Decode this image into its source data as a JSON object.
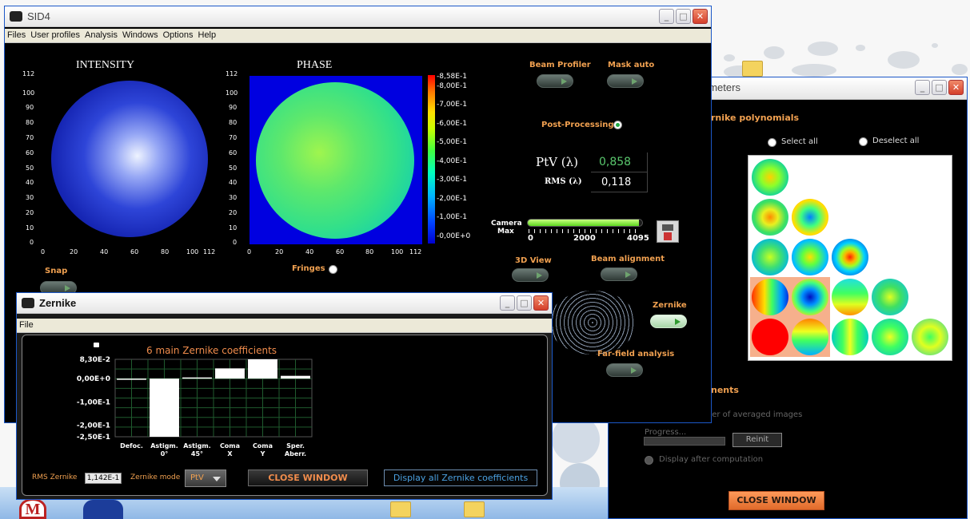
{
  "main_window": {
    "title": "SID4",
    "menu": [
      "Files",
      "User profiles",
      "Analysis",
      "Windows",
      "Options",
      "Help"
    ],
    "intensity": {
      "title": "INTENSITY",
      "y_ticks": [
        "112",
        "100",
        "90",
        "80",
        "70",
        "60",
        "50",
        "40",
        "30",
        "20",
        "10",
        "0"
      ],
      "x_ticks": [
        "0",
        "20",
        "40",
        "60",
        "80",
        "100",
        "112"
      ]
    },
    "phase": {
      "title": "PHASE",
      "y_ticks": [
        "112",
        "100",
        "90",
        "80",
        "70",
        "60",
        "50",
        "40",
        "30",
        "20",
        "10",
        "0"
      ],
      "x_ticks": [
        "0",
        "20",
        "40",
        "60",
        "80",
        "100",
        "112"
      ],
      "colorbar_ticks": [
        "-8,58E-1",
        "-8,00E-1",
        "-7,00E-1",
        "-6,00E-1",
        "-5,00E-1",
        "-4,00E-1",
        "-3,00E-1",
        "-2,00E-1",
        "-1,00E-1",
        "-0,00E+0"
      ]
    },
    "beam_profiler_label": "Beam Profiler",
    "mask_auto_label": "Mask auto",
    "post_processing_label": "Post-Processing",
    "ptv_label": "PtV (λ)",
    "ptv_value": "0,858",
    "rms_label": "RMS (λ)",
    "rms_value": "0,118",
    "camera_label": "Camera",
    "camera_max_label": "Max",
    "camera_ticks": [
      "0",
      "2000",
      "4095"
    ],
    "camera_level": 0.97,
    "view3d_label": "3D View",
    "beam_alignment_label": "Beam alignment",
    "zernike_label": "Zernike",
    "far_field_label": "Far-field analysis",
    "snap_label": "Snap",
    "fringes_label": "Fringes"
  },
  "zernike_window": {
    "title": "Zernike",
    "menu": [
      "File"
    ],
    "chart_title": "6 main Zernike coefficients",
    "rms_label": "RMS Zernike",
    "rms_value": "1,142E-1",
    "mode_label": "Zernike mode",
    "mode_value": "PtV",
    "close_label": "CLOSE WINDOW",
    "display_all_label": "Display all Zernike coefficients"
  },
  "chart_data": {
    "type": "bar",
    "title": "6 main Zernike coefficients",
    "categories": [
      "Defoc.",
      "Astigm. 0°",
      "Astigm. 45°",
      "Coma X",
      "Coma Y",
      "Sper. Aberr."
    ],
    "values": [
      0.0,
      -0.25,
      0.005,
      0.044,
      0.083,
      0.012
    ],
    "ylim": [
      -0.25,
      0.083
    ],
    "y_ticks": [
      "8,30E-2",
      "0,00E+0",
      "-1,00E-1",
      "-2,00E-1",
      "-2,50E-1"
    ],
    "grid": true
  },
  "params_window": {
    "title": "ameters",
    "section_title": "rnike polynomials",
    "select_all": "Select all",
    "deselect_all": "Deselect all",
    "averaging_section": "nents",
    "averaged_label": "ser of averaged images",
    "progress_label": "Progress...",
    "reinit_label": "Reinit",
    "display_after_label": "Display after computation",
    "close_label": "CLOSE WINDOW"
  }
}
